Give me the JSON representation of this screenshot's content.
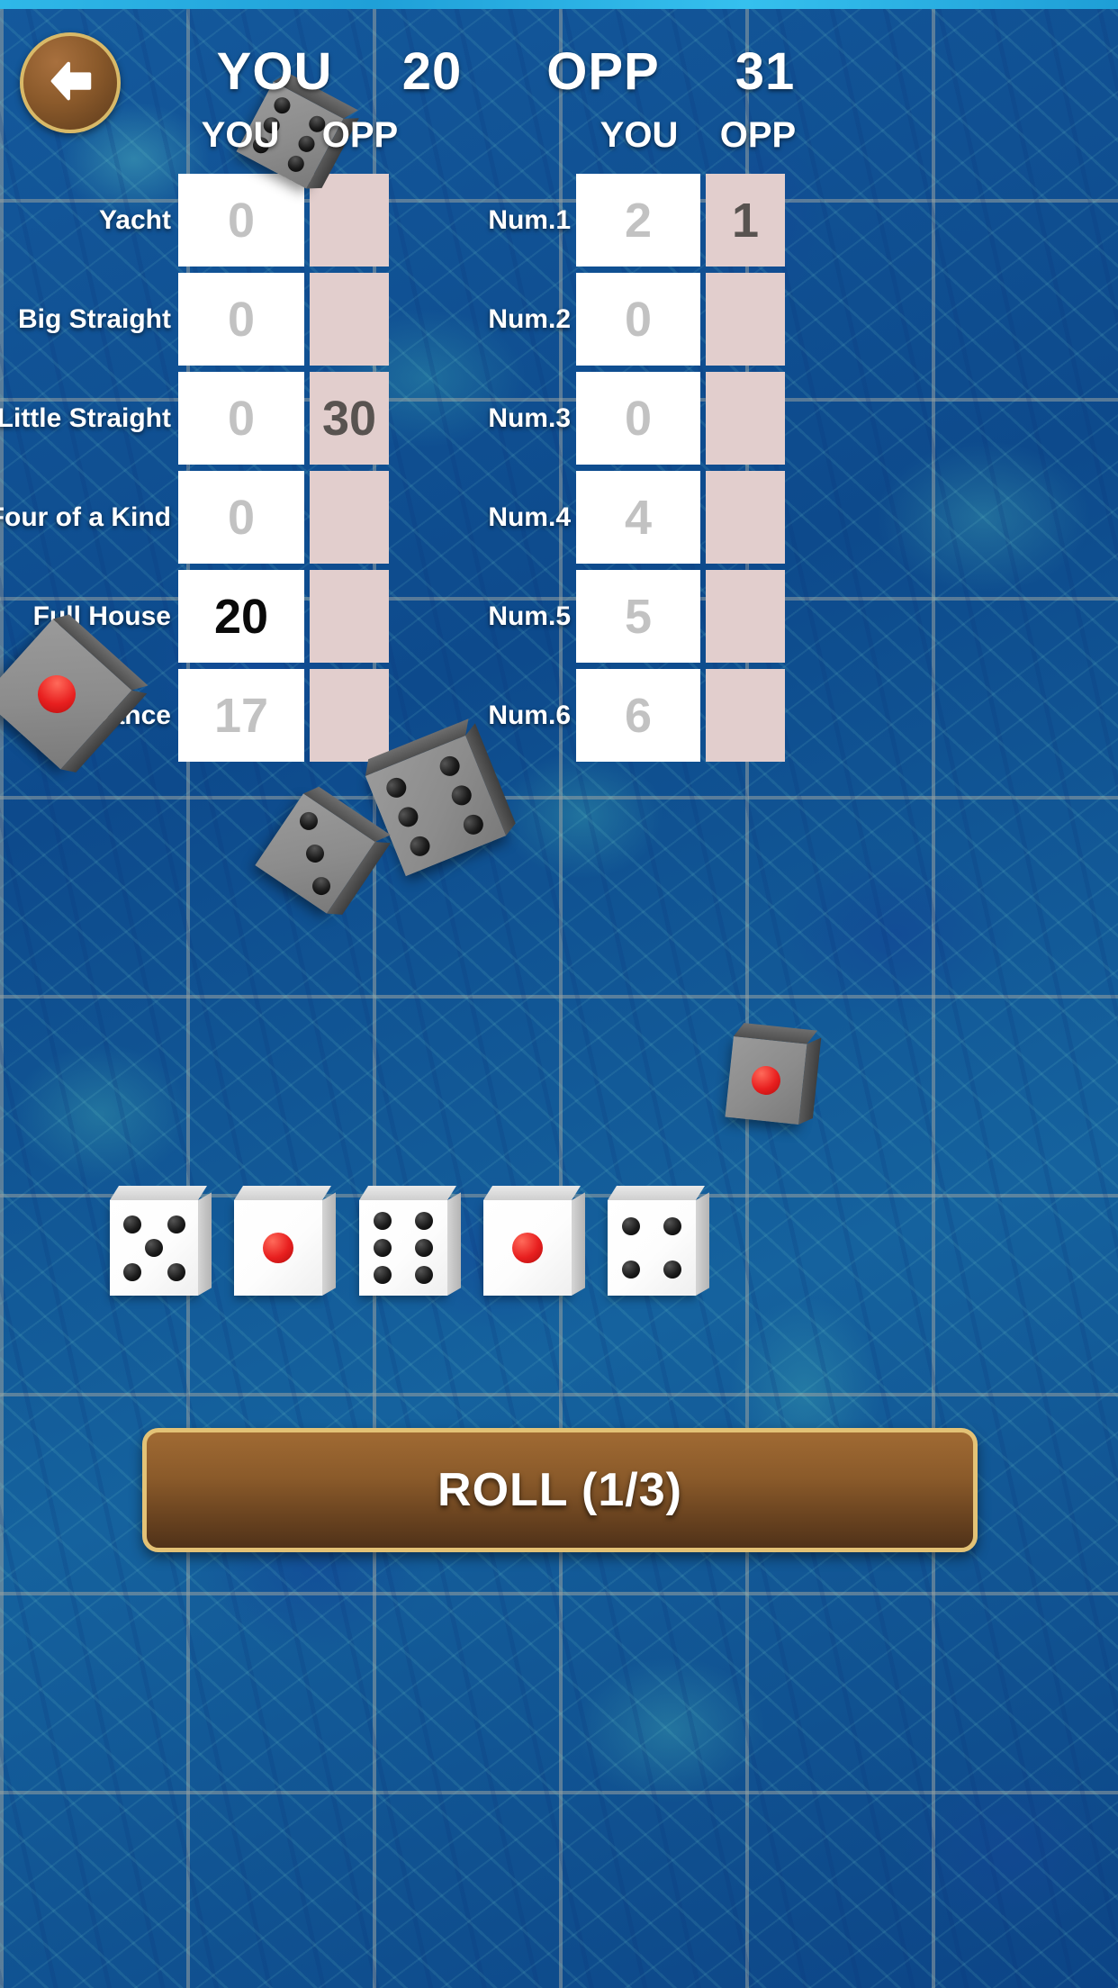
{
  "header": {
    "back_icon": "back-arrow-icon",
    "you_label": "YOU",
    "you_score": "20",
    "opp_label": "OPP",
    "opp_score": "31"
  },
  "left_table": {
    "col_you": "YOU",
    "col_opp": "OPP",
    "rows": [
      {
        "label": "Yacht",
        "you": "0",
        "you_state": "pending",
        "opp": "",
        "opp_state": "empty"
      },
      {
        "label": "Big Straight",
        "you": "0",
        "you_state": "pending",
        "opp": "",
        "opp_state": "empty"
      },
      {
        "label": "Little Straight",
        "you": "0",
        "you_state": "pending",
        "opp": "30",
        "opp_state": "fixed"
      },
      {
        "label": "Four of a Kind",
        "you": "0",
        "you_state": "pending",
        "opp": "",
        "opp_state": "empty"
      },
      {
        "label": "Full House",
        "you": "20",
        "you_state": "fixed",
        "opp": "",
        "opp_state": "empty"
      },
      {
        "label": "Chance",
        "you": "17",
        "you_state": "pending",
        "opp": "",
        "opp_state": "empty"
      }
    ]
  },
  "right_table": {
    "col_you": "YOU",
    "col_opp": "OPP",
    "rows": [
      {
        "label": "Num.1",
        "you": "2",
        "you_state": "pending",
        "opp": "1",
        "opp_state": "fixed"
      },
      {
        "label": "Num.2",
        "you": "0",
        "you_state": "pending",
        "opp": "",
        "opp_state": "empty"
      },
      {
        "label": "Num.3",
        "you": "0",
        "you_state": "pending",
        "opp": "",
        "opp_state": "empty"
      },
      {
        "label": "Num.4",
        "you": "4",
        "you_state": "pending",
        "opp": "",
        "opp_state": "empty"
      },
      {
        "label": "Num.5",
        "you": "5",
        "you_state": "pending",
        "opp": "",
        "opp_state": "empty"
      },
      {
        "label": "Num.6",
        "you": "6",
        "you_state": "pending",
        "opp": "",
        "opp_state": "empty"
      }
    ]
  },
  "dice_tray": {
    "dice": [
      {
        "name": "die-1",
        "value": 5
      },
      {
        "name": "die-2",
        "value": 1
      },
      {
        "name": "die-3",
        "value": 6
      },
      {
        "name": "die-4",
        "value": 1
      },
      {
        "name": "die-5",
        "value": 4
      }
    ]
  },
  "tumbling_dice": [
    {
      "name": "tumbling-die-top",
      "value": 6
    },
    {
      "name": "tumbling-die-left",
      "value": 1
    },
    {
      "name": "tumbling-die-mid-left",
      "value": 3
    },
    {
      "name": "tumbling-die-mid-center",
      "value": 6
    },
    {
      "name": "tumbling-die-right-edge",
      "value": 1
    }
  ],
  "roll_button": {
    "label": "ROLL (1/3)"
  },
  "colors": {
    "you_cell": "#ffffff",
    "opp_cell": "#e2cecd",
    "pending_value": "#c2c2c2",
    "fixed_value": "#0a0a0a",
    "button_gold_border": "#e3c276",
    "button_brown": "#8a5a2a",
    "water_blue": "#0d4a8c",
    "red_pip": "#e81f1f"
  }
}
